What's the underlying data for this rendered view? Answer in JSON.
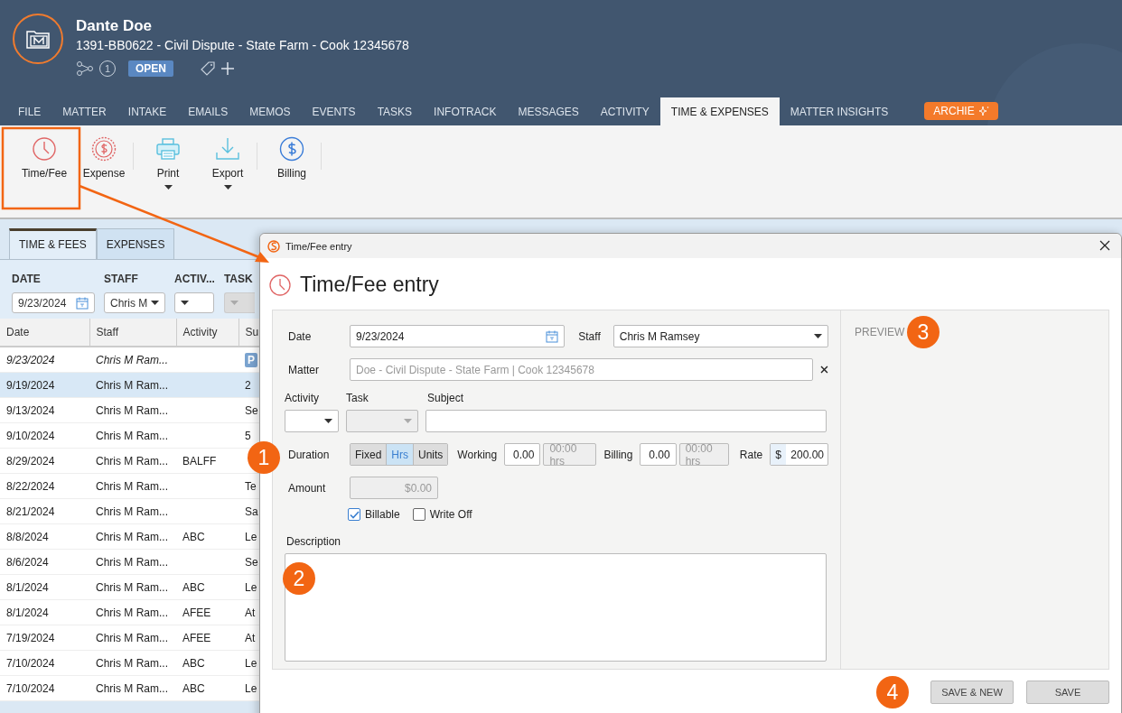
{
  "header": {
    "name": "Dante Doe",
    "matter": "1391-BB0622 - Civil Dispute - State Farm - Cook 12345678",
    "count": "1",
    "status": "OPEN"
  },
  "tabs": [
    {
      "label": "FILE",
      "selected": false,
      "kind": "tab"
    },
    {
      "label": "MATTER",
      "selected": false,
      "kind": "tab"
    },
    {
      "label": "INTAKE",
      "selected": false,
      "kind": "tab"
    },
    {
      "label": "EMAILS",
      "selected": false,
      "kind": "tab"
    },
    {
      "label": "MEMOS",
      "selected": false,
      "kind": "tab"
    },
    {
      "label": "EVENTS",
      "selected": false,
      "kind": "tab"
    },
    {
      "label": "TASKS",
      "selected": false,
      "kind": "tab"
    },
    {
      "label": "INFOTRACK",
      "selected": false,
      "kind": "tab"
    },
    {
      "label": "MESSAGES",
      "selected": false,
      "kind": "tab"
    },
    {
      "label": "ACTIVITY",
      "selected": false,
      "kind": "tab"
    },
    {
      "label": "TIME & EXPENSES",
      "selected": true,
      "kind": "tab"
    },
    {
      "label": "MATTER INSIGHTS",
      "selected": false,
      "kind": "tab"
    },
    {
      "label": "ARCHIE",
      "selected": false,
      "kind": "assistant"
    }
  ],
  "toolbar": [
    {
      "label": "Time/Fee",
      "kind": "clock",
      "dropdown": false,
      "separator_after": false
    },
    {
      "label": "Expense",
      "kind": "coin",
      "dropdown": false,
      "separator_after": true
    },
    {
      "label": "Print",
      "kind": "printer",
      "dropdown": true,
      "separator_after": false
    },
    {
      "label": "Export",
      "kind": "download",
      "dropdown": true,
      "separator_after": true
    },
    {
      "label": "Billing",
      "kind": "dollar",
      "dropdown": false,
      "separator_after": true
    }
  ],
  "subtabs": [
    {
      "label": "TIME & FEES",
      "selected": true
    },
    {
      "label": "EXPENSES",
      "selected": false
    }
  ],
  "filters": [
    {
      "label": "DATE",
      "kind": "date",
      "value": "9/23/2024",
      "disabled": false
    },
    {
      "label": "STAFF",
      "kind": "select",
      "value": "Chris M",
      "disabled": false
    },
    {
      "label": "ACTIV...",
      "kind": "select",
      "disabled": false
    },
    {
      "label": "TASK",
      "kind": "select",
      "disabled": true
    }
  ],
  "table": {
    "columns": [
      "Date",
      "Staff",
      "Activity",
      "Su"
    ],
    "rows": [
      {
        "cells": [
          "9/23/2024",
          "Chris M Ram...",
          "",
          "P"
        ],
        "pending": true,
        "selected": false
      },
      {
        "cells": [
          "9/19/2024",
          "Chris M Ram...",
          "",
          "2"
        ],
        "pending": false,
        "selected": true
      },
      {
        "cells": [
          "9/13/2024",
          "Chris M Ram...",
          "",
          "Se"
        ],
        "pending": false,
        "selected": false
      },
      {
        "cells": [
          "9/10/2024",
          "Chris M Ram...",
          "",
          "5"
        ],
        "pending": false,
        "selected": false
      },
      {
        "cells": [
          "8/29/2024",
          "Chris M Ram...",
          "BALFF",
          ""
        ],
        "pending": false,
        "selected": false
      },
      {
        "cells": [
          "8/22/2024",
          "Chris M Ram...",
          "",
          "Te"
        ],
        "pending": false,
        "selected": false
      },
      {
        "cells": [
          "8/21/2024",
          "Chris M Ram...",
          "",
          "Sa"
        ],
        "pending": false,
        "selected": false
      },
      {
        "cells": [
          "8/8/2024",
          "Chris M Ram...",
          "ABC",
          "Le"
        ],
        "pending": false,
        "selected": false
      },
      {
        "cells": [
          "8/6/2024",
          "Chris M Ram...",
          "",
          "Se"
        ],
        "pending": false,
        "selected": false
      },
      {
        "cells": [
          "8/1/2024",
          "Chris M Ram...",
          "ABC",
          "Le"
        ],
        "pending": false,
        "selected": false
      },
      {
        "cells": [
          "8/1/2024",
          "Chris M Ram...",
          "AFEE",
          "At"
        ],
        "pending": false,
        "selected": false
      },
      {
        "cells": [
          "7/19/2024",
          "Chris M Ram...",
          "AFEE",
          "At"
        ],
        "pending": false,
        "selected": false
      },
      {
        "cells": [
          "7/10/2024",
          "Chris M Ram...",
          "ABC",
          "Le"
        ],
        "pending": false,
        "selected": false
      },
      {
        "cells": [
          "7/10/2024",
          "Chris M Ram...",
          "ABC",
          "Le"
        ],
        "pending": false,
        "selected": false
      }
    ]
  },
  "dialog": {
    "title": "Time/Fee entry",
    "heading": "Time/Fee entry",
    "date": {
      "label": "Date",
      "value": "9/23/2024"
    },
    "staff": {
      "label": "Staff",
      "value": "Chris M Ramsey"
    },
    "matter": {
      "label": "Matter",
      "value": "Doe - Civil Dispute - State Farm | Cook 12345678"
    },
    "activity": {
      "label": "Activity"
    },
    "task": {
      "label": "Task",
      "disabled": true
    },
    "subject": {
      "label": "Subject"
    },
    "duration": {
      "label": "Duration",
      "options": [
        {
          "label": "Fixed",
          "selected": false
        },
        {
          "label": "Hrs",
          "selected": true
        },
        {
          "label": "Units",
          "selected": false
        }
      ]
    },
    "working": {
      "label": "Working",
      "value": "0.00",
      "hours": "00:00 hrs"
    },
    "billing": {
      "label": "Billing",
      "value": "0.00",
      "hours": "00:00 hrs"
    },
    "rate": {
      "label": "Rate",
      "currency": "$",
      "value": "200.00"
    },
    "amount": {
      "label": "Amount",
      "value": "$0.00"
    },
    "checks": [
      {
        "label": "Billable",
        "checked": true
      },
      {
        "label": "Write Off",
        "checked": false
      }
    ],
    "description": {
      "label": "Description"
    },
    "preview": "PREVIEW",
    "buttons": [
      "SAVE & NEW",
      "SAVE"
    ]
  },
  "callouts": [
    "1",
    "2",
    "3",
    "4"
  ]
}
